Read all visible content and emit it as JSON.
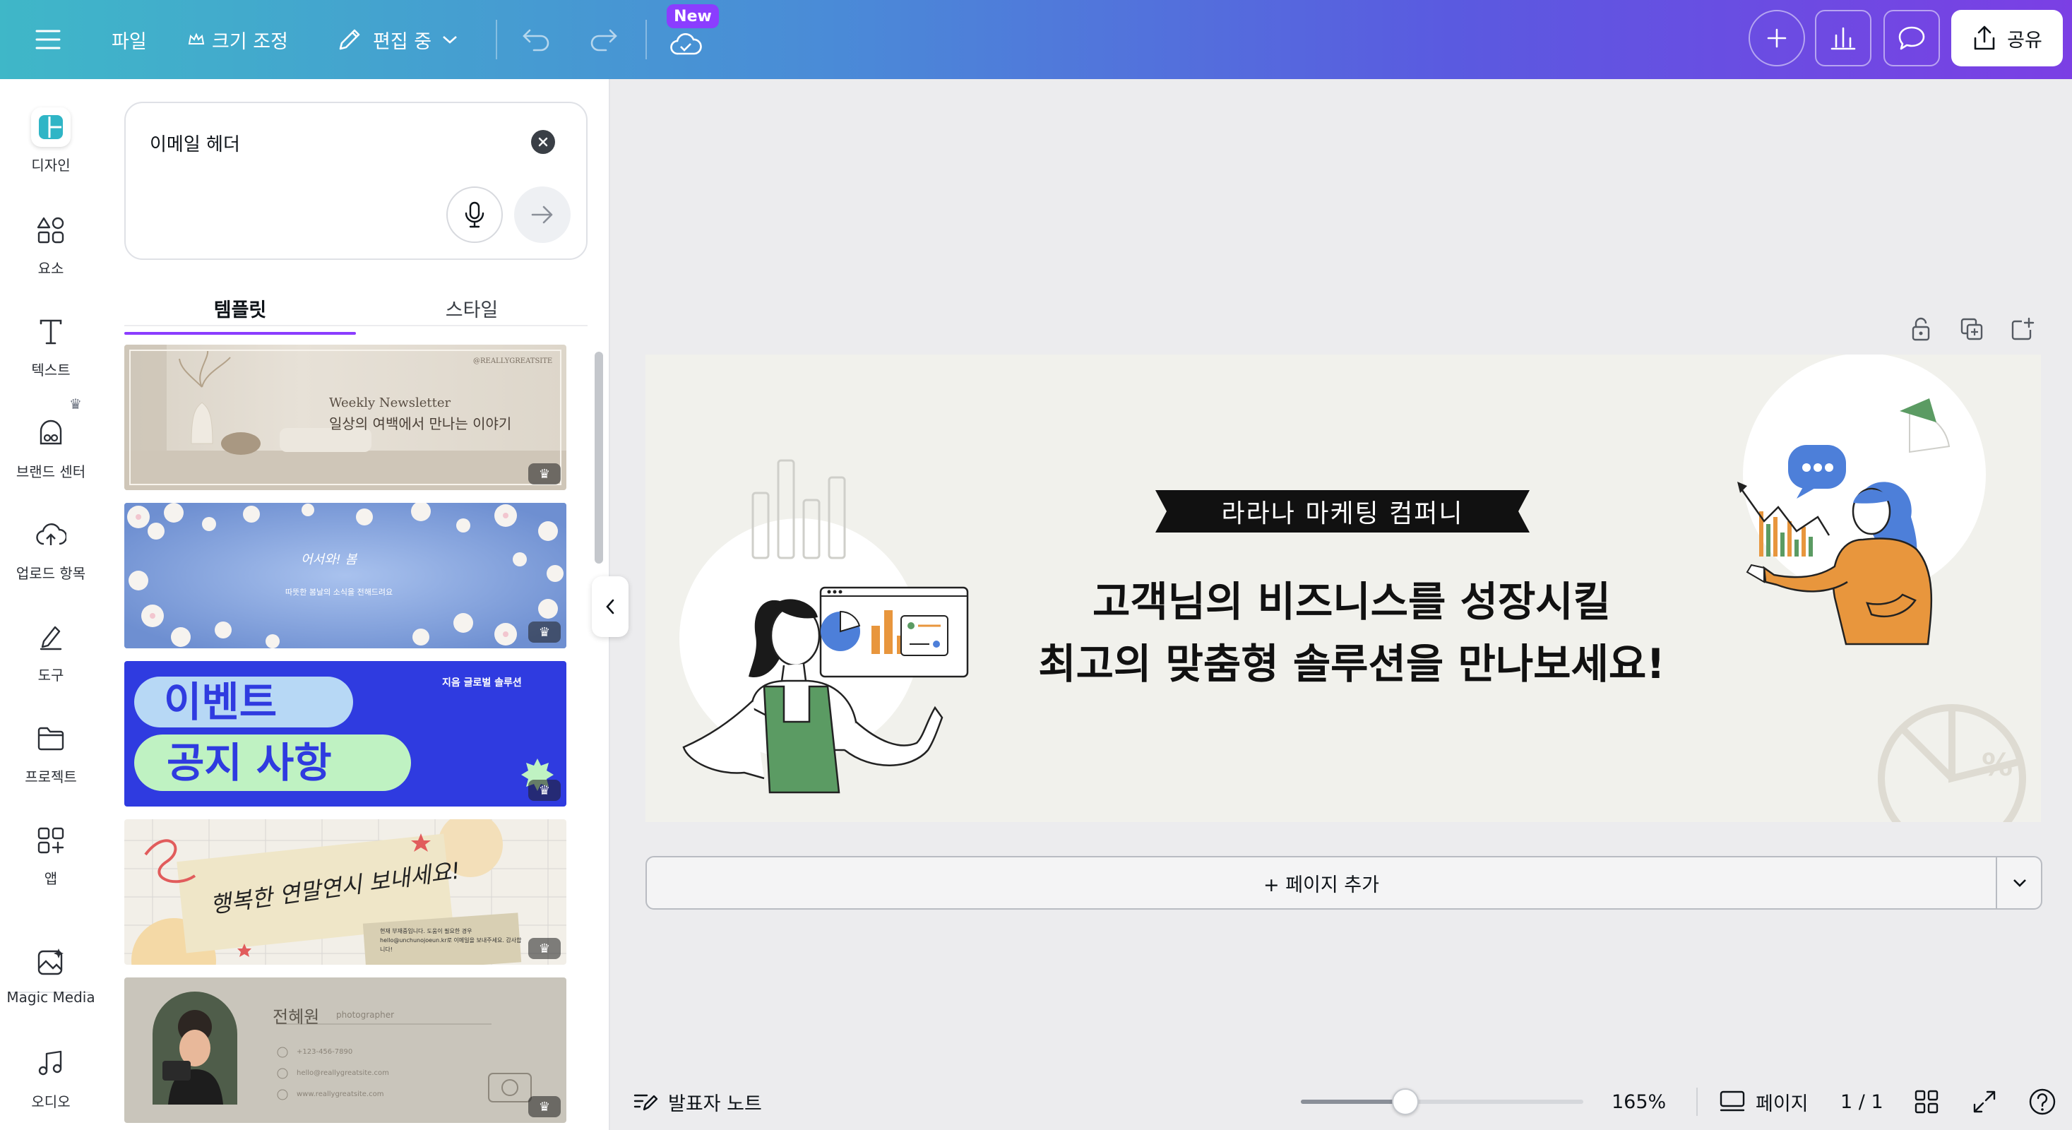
{
  "topbar": {
    "menu_icon": "hamburger-icon",
    "file_label": "파일",
    "resize_label": "크기 조정",
    "edit_label": "편집 중",
    "new_badge": "New",
    "share_label": "공유"
  },
  "rail": {
    "items": [
      {
        "label": "디자인",
        "icon": "design-icon"
      },
      {
        "label": "요소",
        "icon": "elements-icon"
      },
      {
        "label": "텍스트",
        "icon": "text-icon"
      },
      {
        "label": "브랜드 센터",
        "icon": "brand-icon"
      },
      {
        "label": "업로드 항목",
        "icon": "upload-icon"
      },
      {
        "label": "도구",
        "icon": "tools-icon"
      },
      {
        "label": "프로젝트",
        "icon": "folder-icon"
      },
      {
        "label": "앱",
        "icon": "apps-icon"
      },
      {
        "label": "Magic Media",
        "icon": "magic-media-icon"
      },
      {
        "label": "오디오",
        "icon": "audio-icon"
      }
    ]
  },
  "panel": {
    "search_value": "이메일 헤더",
    "tabs": [
      "템플릿",
      "스타일"
    ],
    "templates": [
      {
        "title": "Weekly Newsletter",
        "subtitle": "일상의 여백에서 만나는 이야기",
        "handle": "@REALLYGREATSITE"
      },
      {
        "title": "어서와! 봄",
        "subtitle": "따뜻한 봄날의 소식을 전해드려요"
      },
      {
        "title_1": "이벤트",
        "title_2": "공지 사항",
        "brand": "지음 글로벌 솔루션"
      },
      {
        "title": "행복한 연말연시 보내세요!",
        "note": "현재 부재중입니다. 도움이 필요한 경우 hello@unchunojoeun.kr로 이메일을 보내주세요. 감사합니다!"
      },
      {
        "name": "전혜원",
        "role": "photographer",
        "phone": "+123-456-7890",
        "email": "hello@reallygreatsite.com",
        "site": "www.reallygreatsite.com"
      }
    ]
  },
  "design": {
    "company": "라라나 마케팅 컴퍼니",
    "headline_1": "고객님의 비즈니스를 성장시킬",
    "headline_2": "최고의 맞춤형 솔루션을 만나보세요!"
  },
  "add_page_label": "+ 페이지 추가",
  "bottombar": {
    "notes_label": "발표자 노트",
    "zoom": "165%",
    "zoom_fraction": 0.37,
    "pages_label": "페이지",
    "page_count": "1 / 1"
  },
  "colors": {
    "accent": "#8b3dff",
    "event_bg": "#2f3be0",
    "design_bg": "#f1f1ec"
  }
}
